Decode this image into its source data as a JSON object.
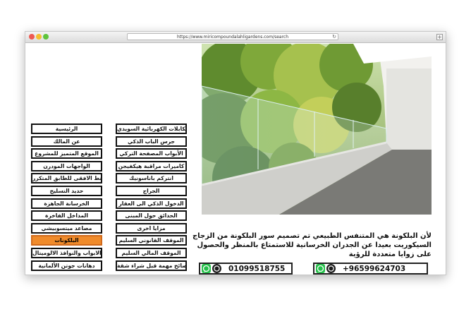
{
  "browser": {
    "url": "https://www.miricompoundalahligardens.com/search",
    "reload_symbol": "↻",
    "new_tab_symbol": "+"
  },
  "hero_image": {
    "subject": "glass balcony railing overlooking trees"
  },
  "menu": {
    "left_column": [
      {
        "label": "الرئيسية",
        "active": false
      },
      {
        "label": "عن المالك",
        "active": false
      },
      {
        "label": "الموقع المتميز للمشروع",
        "active": false
      },
      {
        "label": "الواجهات المودرن",
        "active": false
      },
      {
        "label": "المسقط الافقى للطابق المتكرر",
        "active": false
      },
      {
        "label": "حديد التسليح",
        "active": false
      },
      {
        "label": "الخرسانة الجاهزة",
        "active": false
      },
      {
        "label": "المداخل الفاخرة",
        "active": false
      },
      {
        "label": "مصاعد ميتسوبيشي",
        "active": false
      },
      {
        "label": "البلكونات",
        "active": true
      },
      {
        "label": "الابواب والنوافذ الالوميتال",
        "active": false
      },
      {
        "label": "دهانات جوتن الألمانية",
        "active": false
      }
    ],
    "right_column": [
      {
        "label": "الكابلات الكهربائية السويدي",
        "active": false
      },
      {
        "label": "جرس الباب الذكي",
        "active": false
      },
      {
        "label": "الأبواب المصفحة التركي",
        "active": false
      },
      {
        "label": "كاميرات مراقبة هيكفيجن",
        "active": false
      },
      {
        "label": "انتركم باناسونيك",
        "active": false
      },
      {
        "label": "الجراج",
        "active": false
      },
      {
        "label": "الدخول الذكي الى العقار",
        "active": false
      },
      {
        "label": "الحدائق حول المبنى",
        "active": false
      },
      {
        "label": "مزايا اخرى",
        "active": false
      },
      {
        "label": "الموقف القانوني السليم",
        "active": false
      },
      {
        "label": "الموقف المالي السليم",
        "active": false
      },
      {
        "label": "نصائح مهمة قبل شراء شقة",
        "active": false
      }
    ]
  },
  "description": {
    "text": "لأن البلكونة هي المتنفس الطبيعي تم تصميم سور البلكونة من الزجاج السيكوريت بعيدا عن الجدران الخرسانية للاستمتاع بالمنظر والحصول على زوايا متعددة للرؤية"
  },
  "contacts": [
    {
      "number": "01099518755",
      "icons": [
        "whatsapp-icon",
        "whatsapp-call-icon"
      ]
    },
    {
      "number": "+96599624703",
      "icons": [
        "whatsapp-icon",
        "whatsapp-call-icon"
      ]
    }
  ],
  "colors": {
    "active_menu": "#f08b2b",
    "whatsapp_green": "#25c04a"
  }
}
